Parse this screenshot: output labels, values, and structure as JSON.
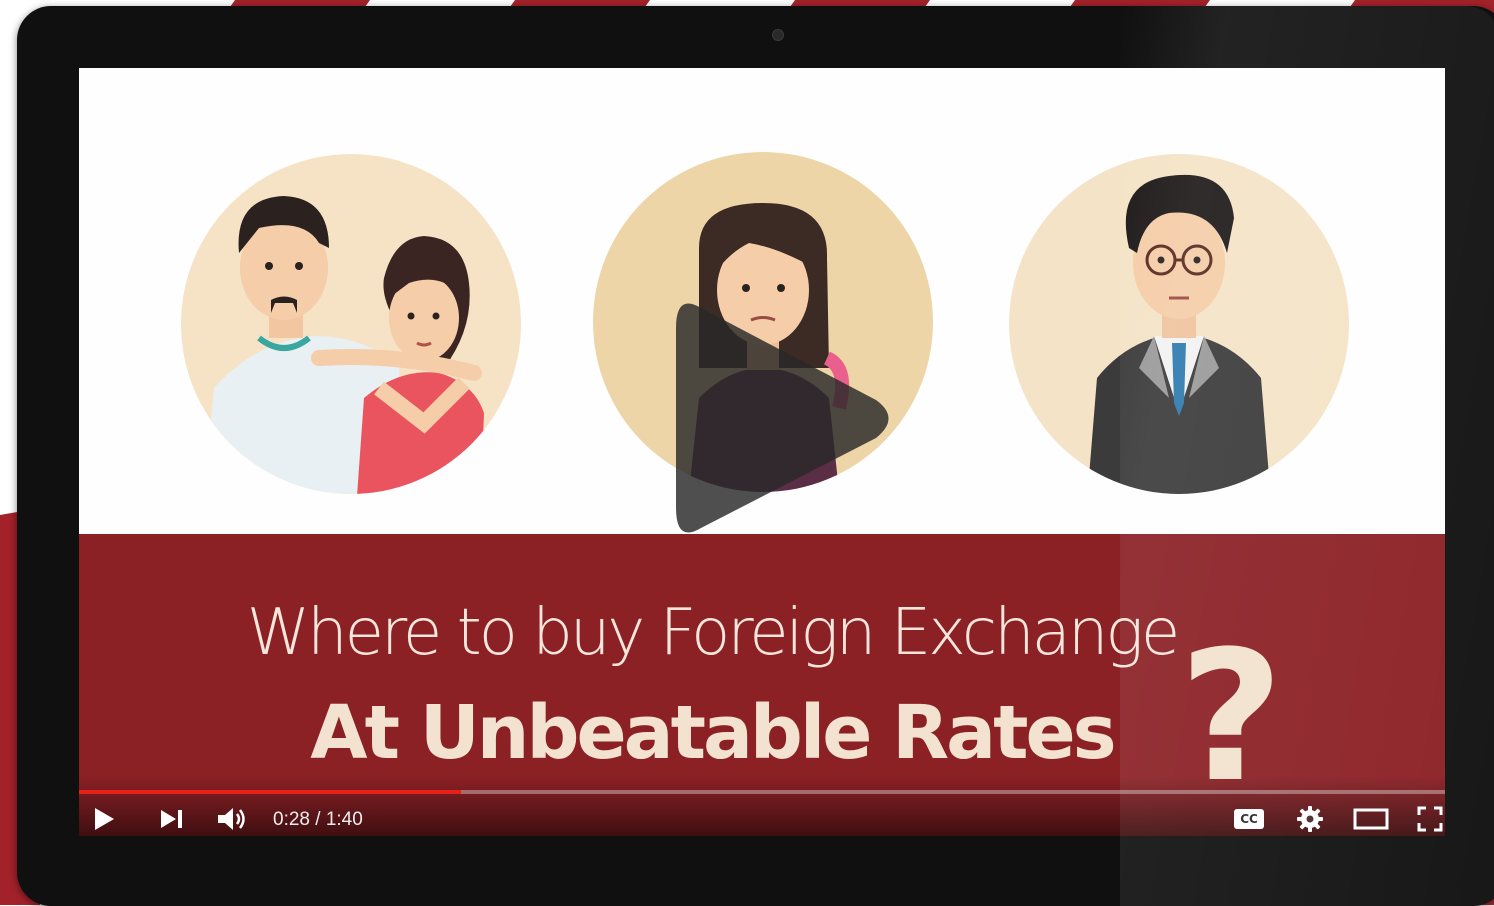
{
  "video": {
    "title_line1": "Where to buy Foreign Exchange",
    "title_line2": "At Unbeatable Rates",
    "title_mark": "?",
    "current_time": "0:28",
    "separator": " / ",
    "duration": "1:40",
    "progress": 0.28
  },
  "controls": {
    "play_icon": "play-icon",
    "next_icon": "next-icon",
    "volume_icon": "volume-icon",
    "cc_label": "CC",
    "settings_icon": "gear-icon",
    "theater_icon": "theater-mode-icon",
    "fullscreen_icon": "fullscreen-icon"
  },
  "colors": {
    "banner": "#8b2025",
    "progress_played": "#e62117",
    "stripe_red": "#a3222a"
  }
}
